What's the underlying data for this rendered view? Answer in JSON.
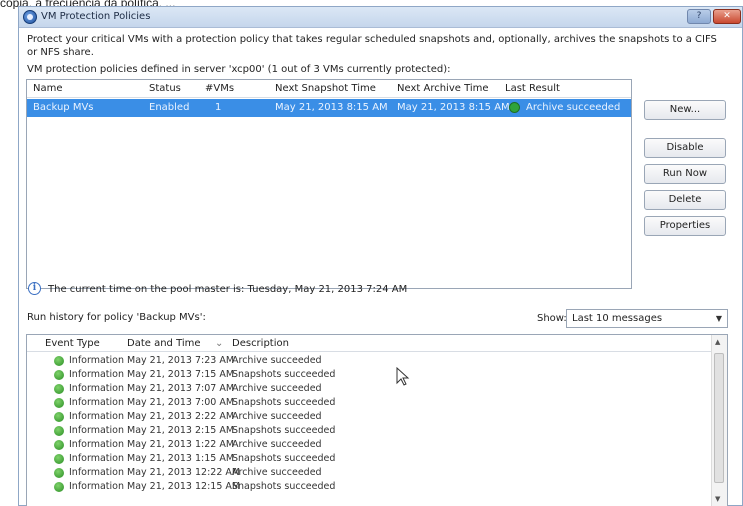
{
  "caption": "cópia, a frecuencia da política, ...",
  "window": {
    "title": "VM Protection Policies"
  },
  "intro": "Protect your critical VMs with a protection policy that takes regular scheduled snapshots and, optionally, archives the snapshots to a CIFS or NFS share.",
  "defined_text": "VM protection policies defined in server 'xcp00' (1 out of 3 VMs currently protected):",
  "policy_table": {
    "columns": [
      "Name",
      "Status",
      "#VMs",
      "Next Snapshot Time",
      "Next Archive Time",
      "Last Result"
    ],
    "rows": [
      {
        "name": "Backup MVs",
        "status": "Enabled",
        "vms": "1",
        "next_snapshot": "May 21, 2013 8:15 AM",
        "next_archive": "May 21, 2013 8:15 AM",
        "last_result": "Archive succeeded",
        "selected": true
      }
    ]
  },
  "buttons": {
    "new": "New...",
    "disable": "Disable",
    "run_now": "Run Now",
    "delete": "Delete",
    "properties": "Properties"
  },
  "current_time": "The current time on the pool master is: Tuesday, May 21, 2013 7:24 AM",
  "run_history_label": "Run history for policy 'Backup MVs':",
  "show": {
    "label": "Show:",
    "value": "Last 10 messages"
  },
  "history_table": {
    "columns": [
      "Event Type",
      "Date and Time",
      "Description"
    ],
    "rows": [
      {
        "type": "Information",
        "time": "May 21, 2013 7:23 AM",
        "desc": "Archive succeeded"
      },
      {
        "type": "Information",
        "time": "May 21, 2013 7:15 AM",
        "desc": "Snapshots succeeded"
      },
      {
        "type": "Information",
        "time": "May 21, 2013 7:07 AM",
        "desc": "Archive succeeded"
      },
      {
        "type": "Information",
        "time": "May 21, 2013 7:00 AM",
        "desc": "Snapshots succeeded"
      },
      {
        "type": "Information",
        "time": "May 21, 2013 2:22 AM",
        "desc": "Archive succeeded"
      },
      {
        "type": "Information",
        "time": "May 21, 2013 2:15 AM",
        "desc": "Snapshots succeeded"
      },
      {
        "type": "Information",
        "time": "May 21, 2013 1:22 AM",
        "desc": "Archive succeeded"
      },
      {
        "type": "Information",
        "time": "May 21, 2013 1:15 AM",
        "desc": "Snapshots succeeded"
      },
      {
        "type": "Information",
        "time": "May 21, 2013 12:22 AM",
        "desc": "Archive succeeded"
      },
      {
        "type": "Information",
        "time": "May 21, 2013 12:15 AM",
        "desc": "Snapshots succeeded"
      }
    ]
  },
  "colors": {
    "selection": "#3a8ee6",
    "success": "#2fa33a",
    "titlebar": "#c5d6ec"
  },
  "icons": {
    "app": "protection-policy-icon",
    "info": "info-icon",
    "result": "check-icon",
    "event": "information-icon"
  }
}
